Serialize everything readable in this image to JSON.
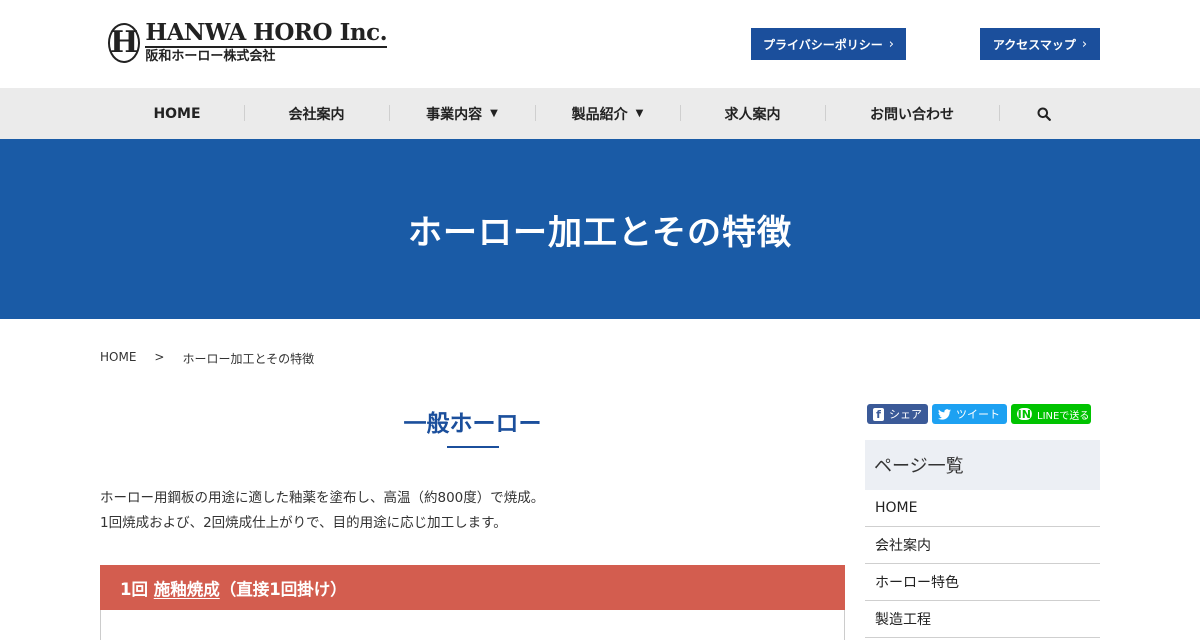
{
  "header": {
    "logo_en": "HANWA HORO Inc.",
    "logo_ja": "阪和ホーロー株式会社",
    "logo_mark": "H",
    "privacy_label": "プライバシーポリシー",
    "access_label": "アクセスマップ",
    "button_color": "#1b4f9c"
  },
  "nav": {
    "items": [
      {
        "label": "HOME"
      },
      {
        "label": "会社案内"
      },
      {
        "label": "事業内容"
      },
      {
        "label": "製品紹介"
      },
      {
        "label": "求人案内"
      },
      {
        "label": "お問い合わせ"
      }
    ],
    "search_icon": "search-icon",
    "dropdown_icon": "chevron-down-icon"
  },
  "hero": {
    "title": "ホーロー加工とその特徴",
    "color": "#1a5ba6"
  },
  "breadcrumb": {
    "home": "HOME",
    "separator": ">",
    "current": "ホーロー加工とその特徴"
  },
  "main": {
    "title": "一般ホーロー",
    "intro_line1": "ホーロー用鋼板の用途に適した釉薬を塗布し、高温（約800度）で焼成。",
    "intro_line2": "1回焼成および、2回焼成仕上がりで、目的用途に応じ加工します。",
    "section": {
      "prefix": "1回 ",
      "underlined": "施釉焼成",
      "suffix": "（直接1回掛け）",
      "color": "#d35d4f"
    }
  },
  "share": {
    "facebook_label": "シェア",
    "twitter_label": "ツイート",
    "line_label": "LINEで送る",
    "line_icon_text": "LINE"
  },
  "sidebar": {
    "heading": "ページ一覧",
    "items": [
      {
        "label": "HOME"
      },
      {
        "label": "会社案内"
      },
      {
        "label": "ホーロー特色"
      },
      {
        "label": "製造工程"
      }
    ]
  }
}
